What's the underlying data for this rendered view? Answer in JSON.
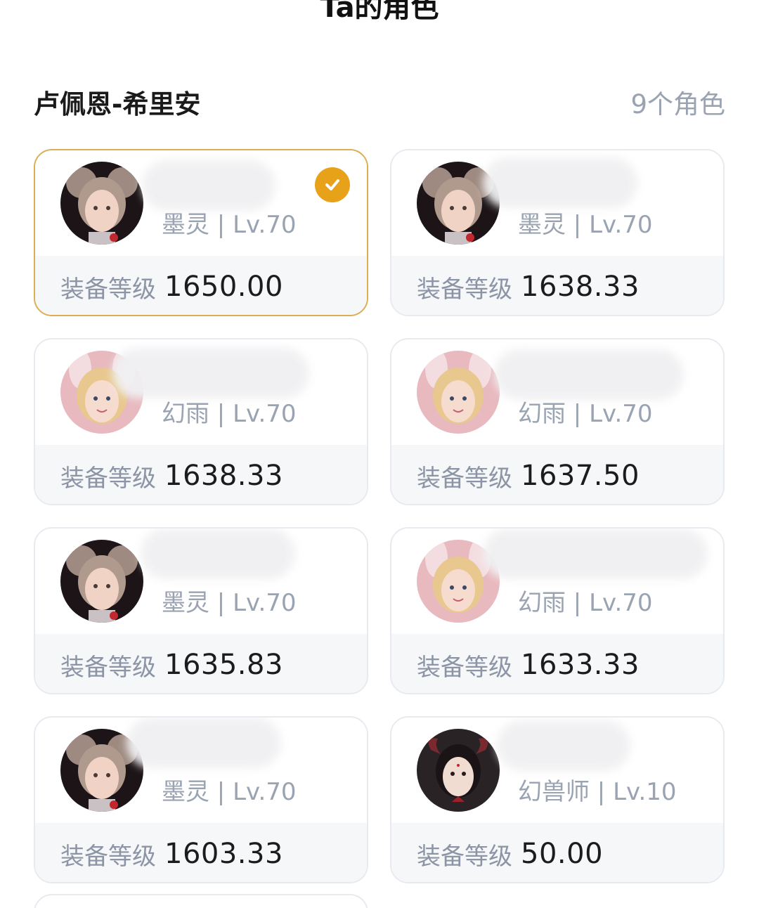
{
  "page": {
    "title": "Ta的角色"
  },
  "server": {
    "name": "卢佩恩-希里安",
    "role_count": "9个角色"
  },
  "gear_label": "装备等级",
  "cards": [
    {
      "class_level": "墨灵 | Lv.70",
      "gear_score": "1650.00",
      "selected": true,
      "avatar": "moling-avatar"
    },
    {
      "class_level": "墨灵 | Lv.70",
      "gear_score": "1638.33",
      "selected": false,
      "avatar": "moling-avatar"
    },
    {
      "class_level": "幻雨 | Lv.70",
      "gear_score": "1638.33",
      "selected": false,
      "avatar": "huanyu-avatar"
    },
    {
      "class_level": "幻雨 | Lv.70",
      "gear_score": "1637.50",
      "selected": false,
      "avatar": "huanyu-avatar"
    },
    {
      "class_level": "墨灵 | Lv.70",
      "gear_score": "1635.83",
      "selected": false,
      "avatar": "moling-avatar"
    },
    {
      "class_level": "幻雨 | Lv.70",
      "gear_score": "1633.33",
      "selected": false,
      "avatar": "huanyu-avatar"
    },
    {
      "class_level": "墨灵 | Lv.70",
      "gear_score": "1603.33",
      "selected": false,
      "avatar": "moling-avatar"
    },
    {
      "class_level": "幻兽师 | Lv.10",
      "gear_score": "50.00",
      "selected": false,
      "avatar": "huanshoushi-avatar"
    }
  ],
  "colors": {
    "accent": "#e8a21a",
    "selected_border": "#dcae54",
    "muted_text": "#9aa3b2"
  }
}
